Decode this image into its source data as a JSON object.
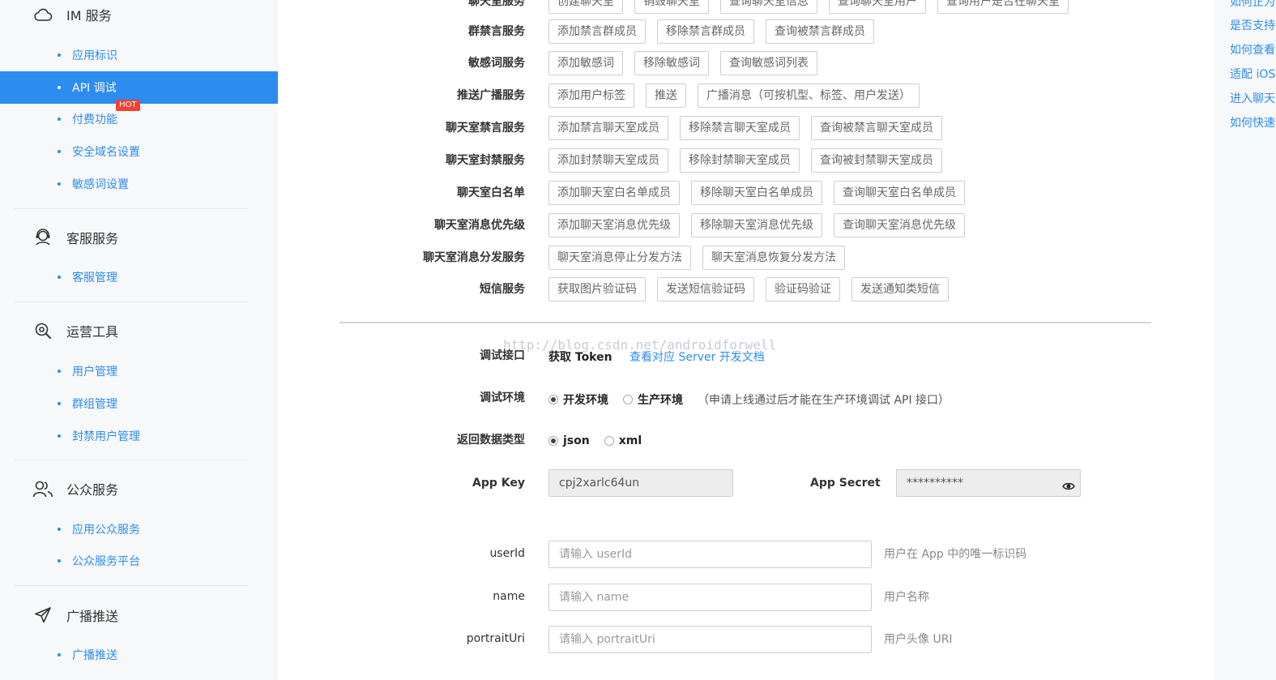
{
  "sidebar": {
    "groups": [
      {
        "title": "IM 服务",
        "icon": "cloud-icon",
        "items": [
          {
            "label": "应用标识"
          },
          {
            "label": "API 调试"
          },
          {
            "label": "付费功能",
            "badge": "HOT"
          },
          {
            "label": "安全域名设置"
          },
          {
            "label": "敏感词设置"
          }
        ]
      },
      {
        "title": "客服服务",
        "icon": "headset-icon",
        "items": [
          {
            "label": "客服管理"
          }
        ]
      },
      {
        "title": "运营工具",
        "icon": "search-gear-icon",
        "items": [
          {
            "label": "用户管理"
          },
          {
            "label": "群组管理"
          },
          {
            "label": "封禁用户管理"
          }
        ]
      },
      {
        "title": "公众服务",
        "icon": "users-icon",
        "items": [
          {
            "label": "应用公众服务"
          },
          {
            "label": "公众服务平台"
          }
        ]
      },
      {
        "title": "广播推送",
        "icon": "send-icon",
        "items": [
          {
            "label": "广播推送"
          }
        ]
      }
    ],
    "active_item": "API 调试"
  },
  "services": [
    {
      "label": "聊天室服务",
      "buttons": [
        "创建聊天室",
        "销毁聊天室",
        "查询聊天室信息",
        "查询聊天室用户",
        "查询用户是否在聊天室"
      ]
    },
    {
      "label": "群禁言服务",
      "buttons": [
        "添加禁言群成员",
        "移除禁言群成员",
        "查询被禁言群成员"
      ]
    },
    {
      "label": "敏感词服务",
      "buttons": [
        "添加敏感词",
        "移除敏感词",
        "查询敏感词列表"
      ]
    },
    {
      "label": "推送广播服务",
      "buttons": [
        "添加用户标签",
        "推送",
        "广播消息（可按机型、标签、用户发送）"
      ]
    },
    {
      "label": "聊天室禁言服务",
      "buttons": [
        "添加禁言聊天室成员",
        "移除禁言聊天室成员",
        "查询被禁言聊天室成员"
      ]
    },
    {
      "label": "聊天室封禁服务",
      "buttons": [
        "添加封禁聊天室成员",
        "移除封禁聊天室成员",
        "查询被封禁聊天室成员"
      ]
    },
    {
      "label": "聊天室白名单",
      "buttons": [
        "添加聊天室白名单成员",
        "移除聊天室白名单成员",
        "查询聊天室白名单成员"
      ]
    },
    {
      "label": "聊天室消息优先级",
      "buttons": [
        "添加聊天室消息优先级",
        "移除聊天室消息优先级",
        "查询聊天室消息优先级"
      ]
    },
    {
      "label": "聊天室消息分发服务",
      "buttons": [
        "聊天室消息停止分发方法",
        "聊天室消息恢复分发方法"
      ]
    },
    {
      "label": "短信服务",
      "buttons": [
        "获取图片验证码",
        "发送短信验证码",
        "验证码验证",
        "发送通知类短信"
      ]
    }
  ],
  "watermark": "http://blog.csdn.net/androidforwell",
  "debug": {
    "interface_label": "调试接口",
    "interface_value": "获取 Token",
    "doc_link": "查看对应 Server 开发文档",
    "env_label": "调试环境",
    "env_options": [
      "开发环境",
      "生产环境"
    ],
    "env_selected": "开发环境",
    "env_note": "（申请上线通过后才能在生产环境调试 API 接口）",
    "format_label": "返回数据类型",
    "format_options": [
      "json",
      "xml"
    ],
    "format_selected": "json",
    "app_key_label": "App Key",
    "app_key_value": "cpj2xarlc64un",
    "app_secret_label": "App Secret",
    "app_secret_value": "**********"
  },
  "fields": [
    {
      "label": "userId",
      "placeholder": "请输入 userId",
      "hint": "用户在 App 中的唯一标识码"
    },
    {
      "label": "name",
      "placeholder": "请输入 name",
      "hint": "用户名称"
    },
    {
      "label": "portraitUri",
      "placeholder": "请输入 portraitUri",
      "hint": "用户头像 URI"
    }
  ],
  "right_links": [
    "如何正为",
    "是否支持",
    "如何查看",
    "适配 iOS",
    "进入聊天",
    "如何快速"
  ],
  "colors": {
    "accent": "#2d8cf0",
    "hot": "#f04134",
    "sidebar_bg": "#f7f8fa"
  }
}
